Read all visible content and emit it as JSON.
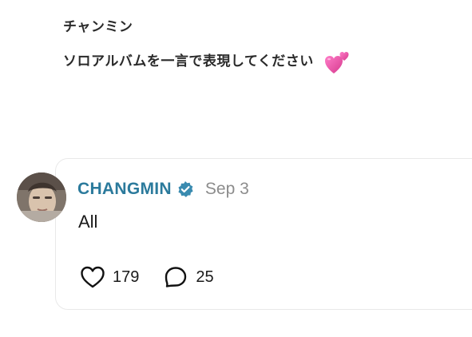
{
  "header": {
    "name": "チャンミン",
    "question": "ソロアルバムを一言で表現してください",
    "emoji_icon": "two-hearts-icon"
  },
  "post": {
    "author": "CHANGMIN",
    "verified_icon": "verified-badge-icon",
    "date": "Sep 3",
    "text": "All",
    "likes": "179",
    "comments": "25",
    "like_icon": "heart-icon",
    "comment_icon": "comment-bubble-icon"
  },
  "colors": {
    "author": "#2b7a9c",
    "verified": "#3a8bb0",
    "date": "#8c8c8c",
    "heart_emoji": "#e94a9c"
  }
}
